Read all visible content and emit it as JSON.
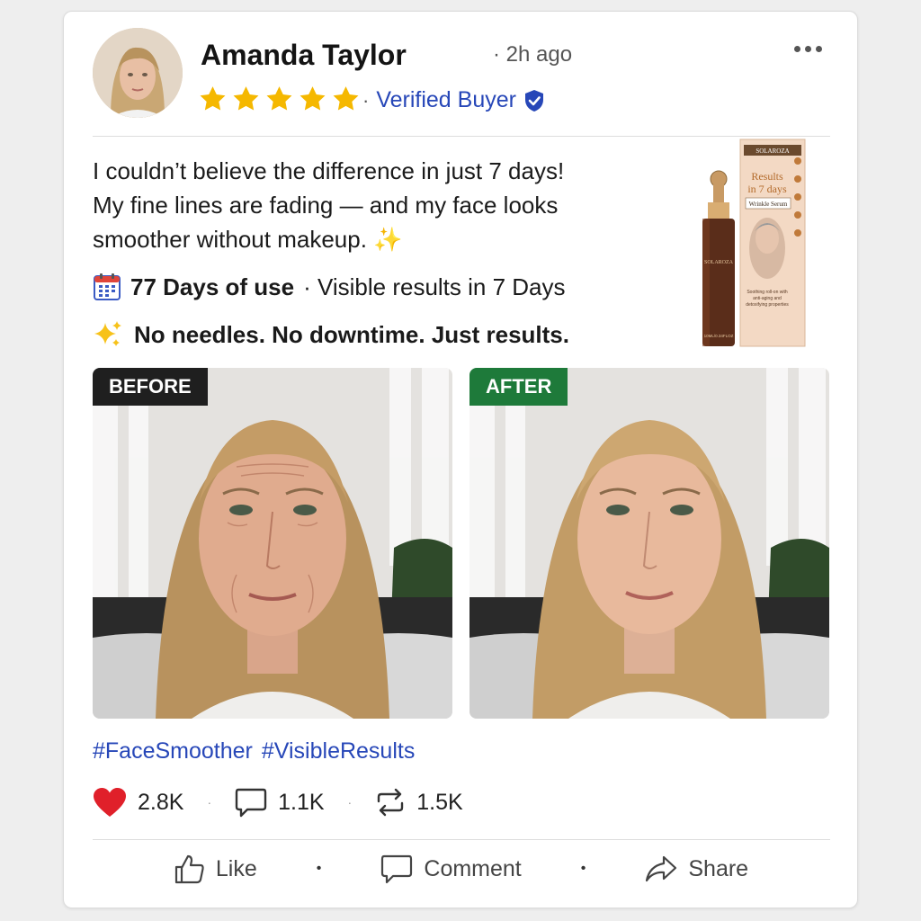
{
  "post": {
    "author": "Amanda Taylor",
    "time": "· 2h ago",
    "rating": 5,
    "verified_label": "Verified Buyer",
    "review_lines": [
      "I couldn’t believe the difference in just 7 days!",
      "My fine lines are fading — and my face looks",
      "smoother without makeup. ✨"
    ],
    "usage_bold": "77 Days of use",
    "usage_rest": "· Visible results in 7 Days",
    "tagline": "No needles. No downtime. Just results.",
    "before_label": "BEFORE",
    "after_label": "AFTER",
    "hashtags": [
      "#FaceSmoother",
      "#VisibleResults"
    ],
    "stats": {
      "likes": "2.8K",
      "comments": "1.1K",
      "reposts": "1.5K"
    },
    "actions": {
      "like": "Like",
      "comment": "Comment",
      "share": "Share"
    }
  },
  "product": {
    "brand": "SOLAROZA",
    "box_title_1": "Results",
    "box_title_2": "in 7 days",
    "box_subtitle": "Wrinkle Serum",
    "box_note": "Soothing roll-on with anti-aging and detoxifying properties",
    "bottle_label": "SOLAROZA",
    "bottle_volume": "10ML/0.34FLOZ"
  },
  "colors": {
    "star": "#f5b800",
    "link": "#2747b8",
    "before_bg": "#1f1f1f",
    "after_bg": "#1e7a3a",
    "heart": "#e0202a"
  }
}
